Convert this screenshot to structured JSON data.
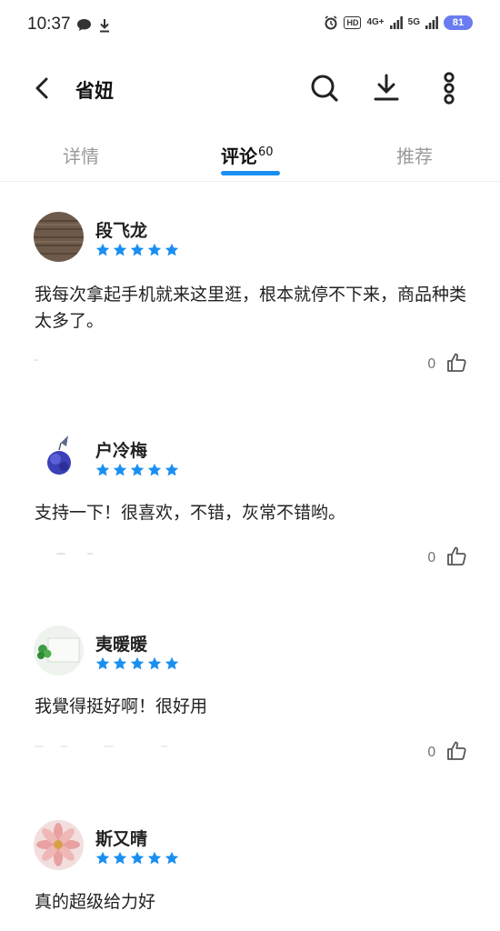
{
  "status_bar": {
    "time": "10:37",
    "hd": "HD",
    "network1": "4G+",
    "network2": "5G",
    "battery": "81"
  },
  "header": {
    "title": "省妞"
  },
  "tabs": {
    "details": "详情",
    "comments": "评论",
    "comments_count": "60",
    "recommend": "推荐"
  },
  "comments": [
    {
      "user": "段飞龙",
      "rating": 5,
      "text": "我每次拿起手机就来这里逛，根本就停不下来，商品种类太多了。",
      "likes": "0"
    },
    {
      "user": "户冷梅",
      "rating": 5,
      "text": "支持一下！很喜欢，不错，灰常不错哟。",
      "likes": "0"
    },
    {
      "user": "夷暖暖",
      "rating": 5,
      "text": "我覺得挺好啊！很好用",
      "likes": "0"
    },
    {
      "user": "斯又晴",
      "rating": 5,
      "text": "真的超级给力好",
      "likes": ""
    }
  ],
  "colors": {
    "accent": "#1a8ff2",
    "star": "#1a8ff2",
    "battery": "#6b7cf0"
  }
}
